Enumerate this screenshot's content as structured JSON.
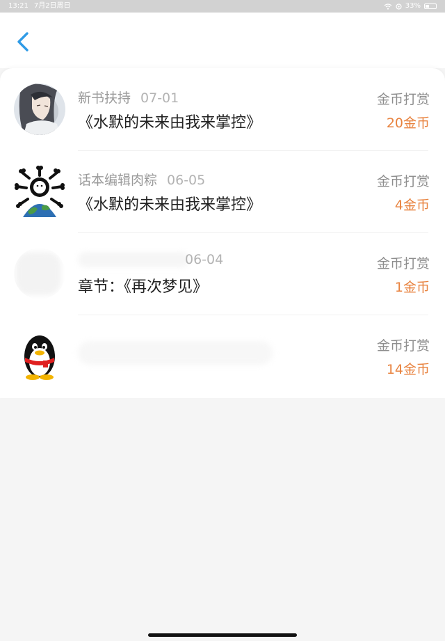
{
  "status_bar": {
    "time": "13:21",
    "date": "7月2日周日",
    "battery": "33%"
  },
  "header": {
    "back_icon": "chevron-left-icon"
  },
  "colors": {
    "accent_blue": "#2f9be6",
    "reward_orange": "#e8823e"
  },
  "records": [
    {
      "user": "新书扶持",
      "date": "07-01",
      "title": "《水默的未来由我来掌控》",
      "reward_label": "金币打赏",
      "amount": "20金币",
      "avatar": "anime-character-avatar"
    },
    {
      "user": "话本编辑肉粽",
      "date": "06-05",
      "title": "《水默的未来由我来掌控》",
      "reward_label": "金币打赏",
      "amount": "4金币",
      "avatar": "bone-earth-avatar"
    },
    {
      "user": "",
      "date": "06-04",
      "title": "章节：《再次梦见》",
      "reward_label": "金币打赏",
      "amount": "1金币",
      "avatar": "blurred-avatar"
    },
    {
      "user": "",
      "date": "",
      "title": "",
      "reward_label": "金币打赏",
      "amount": "14金币",
      "avatar": "penguin-avatar"
    }
  ]
}
